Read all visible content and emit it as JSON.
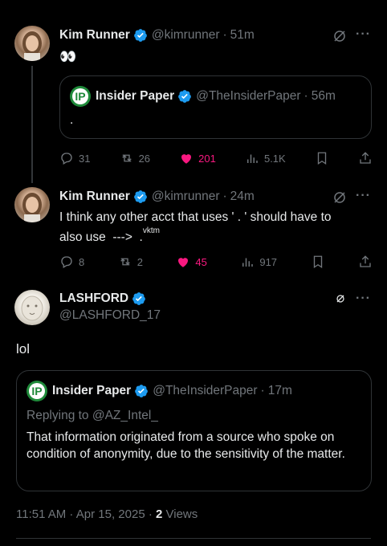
{
  "tweet1": {
    "name": "Kim Runner",
    "handle": "@kimrunner",
    "time": "51m",
    "text": "👀",
    "quote": {
      "name": "Insider Paper",
      "handle": "@TheInsiderPaper",
      "time": "56m",
      "text": "."
    },
    "replies": "31",
    "reposts": "26",
    "likes": "201",
    "views": "5.1K"
  },
  "tweet2": {
    "name": "Kim Runner",
    "handle": "@kimrunner",
    "time": "24m",
    "text_line1": "I think any other acct that uses ' . ' should have to",
    "text_line2": "also use  --->  .",
    "sup": "vktm",
    "replies": "8",
    "reposts": "2",
    "likes": "45",
    "views": "917"
  },
  "tweet3": {
    "name": "LASHFORD",
    "handle": "@LASHFORD_17",
    "text": "lol",
    "quote": {
      "name": "Insider Paper",
      "handle": "@TheInsiderPaper",
      "time": "17m",
      "replying": "Replying to @AZ_Intel_",
      "text": "That information originated from a source who spoke on condition of anonymity, due to the sensitivity of the matter."
    },
    "timestamp": "11:51 AM · Apr 15, 2025 · ",
    "views_count": "2",
    "views_label": " Views"
  },
  "colors": {
    "verified": "#1d9bf0",
    "like": "#f91880",
    "muted": "#71767b",
    "text": "#e7e9ea"
  },
  "icons": [
    "reply-icon",
    "repost-icon",
    "like-icon",
    "views-icon",
    "bookmark-icon",
    "share-icon",
    "grok-icon",
    "more-icon",
    "verified-icon"
  ],
  "symbols": {
    "sep": "·"
  }
}
